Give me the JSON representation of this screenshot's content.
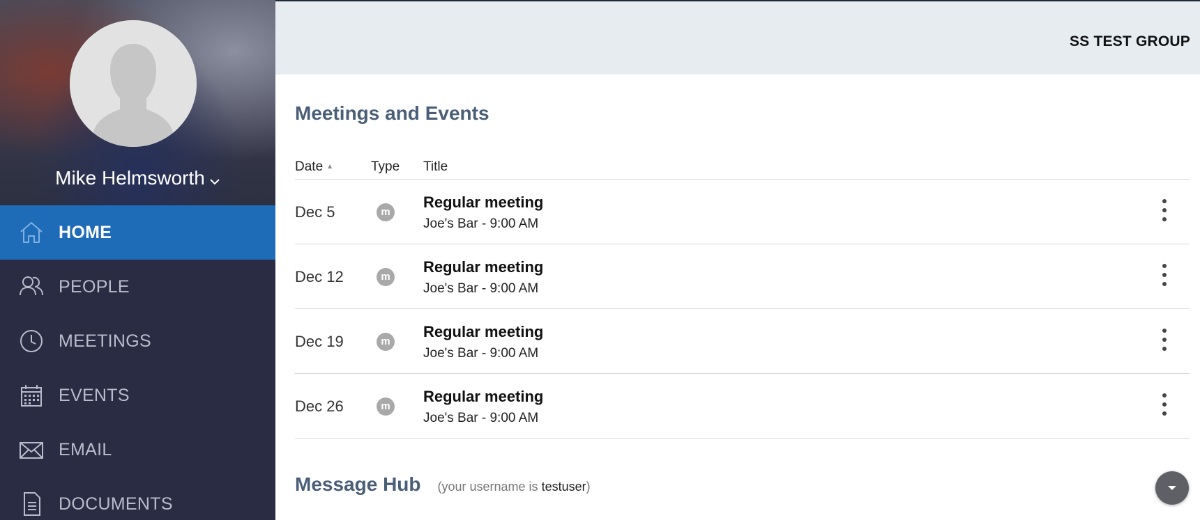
{
  "profile": {
    "name": "Mike Helmsworth"
  },
  "nav": {
    "items": [
      {
        "label": "HOME",
        "icon": "home-icon",
        "active": true
      },
      {
        "label": "PEOPLE",
        "icon": "people-icon",
        "active": false
      },
      {
        "label": "MEETINGS",
        "icon": "clock-icon",
        "active": false
      },
      {
        "label": "EVENTS",
        "icon": "calendar-icon",
        "active": false
      },
      {
        "label": "EMAIL",
        "icon": "envelope-icon",
        "active": false
      },
      {
        "label": "DOCUMENTS",
        "icon": "document-icon",
        "active": false
      }
    ]
  },
  "header": {
    "group_name": "SS TEST GROUP"
  },
  "meetings": {
    "title": "Meetings and Events",
    "columns": {
      "date": "Date",
      "type": "Type",
      "title": "Title"
    },
    "rows": [
      {
        "date": "Dec 5",
        "type_icon": "m",
        "title": "Regular meeting",
        "subtitle": "Joe's Bar - 9:00 AM"
      },
      {
        "date": "Dec 12",
        "type_icon": "m",
        "title": "Regular meeting",
        "subtitle": "Joe's Bar - 9:00 AM"
      },
      {
        "date": "Dec 19",
        "type_icon": "m",
        "title": "Regular meeting",
        "subtitle": "Joe's Bar - 9:00 AM"
      },
      {
        "date": "Dec 26",
        "type_icon": "m",
        "title": "Regular meeting",
        "subtitle": "Joe's Bar - 9:00 AM"
      }
    ]
  },
  "message_hub": {
    "title": "Message Hub",
    "note_prefix": "(your username is ",
    "username": "testuser",
    "note_suffix": ")"
  },
  "colors": {
    "sidebar_bg": "#292c42",
    "active_nav": "#1e6bb8",
    "header_bg": "#e6ecf0",
    "section_title": "#4a5e78"
  }
}
